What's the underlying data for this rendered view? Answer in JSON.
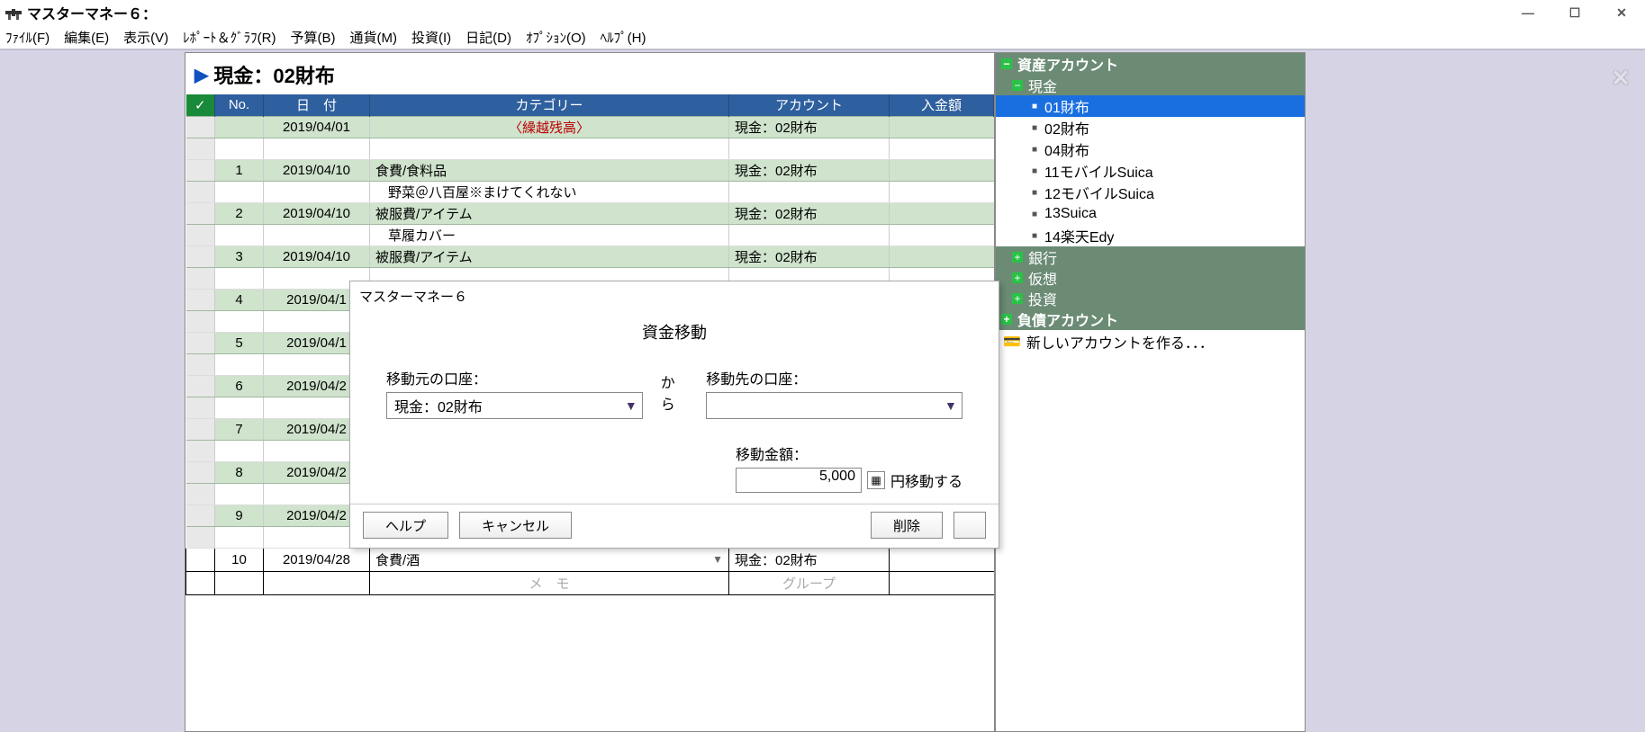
{
  "app": {
    "title": "マスターマネー６："
  },
  "menu": [
    "ﾌｧｲﾙ(F)",
    "編集(E)",
    "表示(V)",
    "ﾚﾎﾟｰﾄ＆ｸﾞﾗﾌ(R)",
    "予算(B)",
    "通貨(M)",
    "投資(I)",
    "日記(D)",
    "ｵﾌﾟｼｮﾝ(O)",
    "ﾍﾙﾌﾟ(H)"
  ],
  "ledger_title": "現金：02財布",
  "cols": {
    "check": "✓",
    "no": "No.",
    "date": "日　付",
    "cat": "カテゴリー",
    "acct": "アカウント",
    "amt": "入金額"
  },
  "carryover": {
    "date": "2019/04/01",
    "label": "〈繰越残高〉",
    "acct": "現金：02財布"
  },
  "rows": [
    {
      "no": "1",
      "date": "2019/04/10",
      "cat": "食費/食料品",
      "acct": "現金：02財布",
      "memo": "野菜＠八百屋※まけてくれない"
    },
    {
      "no": "2",
      "date": "2019/04/10",
      "cat": "被服費/アイテム",
      "acct": "現金：02財布",
      "memo": "草履カバー"
    },
    {
      "no": "3",
      "date": "2019/04/10",
      "cat": "被服費/アイテム",
      "acct": "現金：02財布"
    },
    {
      "no": "4",
      "date": "2019/04/1"
    },
    {
      "no": "5",
      "date": "2019/04/1"
    },
    {
      "no": "6",
      "date": "2019/04/2"
    },
    {
      "no": "7",
      "date": "2019/04/2"
    },
    {
      "no": "8",
      "date": "2019/04/2"
    },
    {
      "no": "9",
      "date": "2019/04/2"
    }
  ],
  "edit_row": {
    "no": "10",
    "date": "2019/04/28",
    "cat": "食費/酒",
    "acct": "現金：02財布",
    "memo_ph": "メ　モ",
    "group_ph": "グループ"
  },
  "dialog": {
    "title": "マスターマネー６",
    "heading": "資金移動",
    "from_label": "移動元の口座：",
    "from_value": "現金：02財布",
    "kara": "から",
    "to_label": "移動先の口座：",
    "to_value": "",
    "amt_label": "移動金額：",
    "amt_value": "5,000",
    "amt_suffix": "円移動する",
    "help": "ヘルプ",
    "cancel": "キャンセル",
    "delete": "削除"
  },
  "tree": {
    "assets_hdr": "資産アカウント",
    "cash": "現金",
    "accounts": [
      "01財布",
      "02財布",
      "04財布",
      "11モバイルSuica",
      "12モバイルSuica",
      "13Suica",
      "14楽天Edy"
    ],
    "selected_index": 0,
    "bank": "銀行",
    "virtual": "仮想",
    "invest": "投資",
    "debt_hdr": "負債アカウント",
    "new": "新しいアカウントを作る．．．"
  }
}
